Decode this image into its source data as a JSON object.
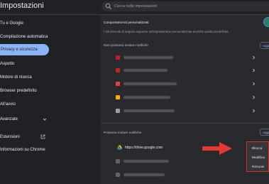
{
  "app": {
    "title": "Impostazioni"
  },
  "search": {
    "placeholder": "Cerca nelle impostazioni"
  },
  "sidebar": {
    "items": [
      {
        "label": "Tu e Google",
        "active": false
      },
      {
        "label": "Compilazione automatica",
        "active": false
      },
      {
        "label": "Privacy e sicurezza",
        "active": true
      },
      {
        "label": "Aspetto",
        "active": false
      },
      {
        "label": "Motore di ricerca",
        "active": false
      },
      {
        "label": "Browser predefinito",
        "active": false
      },
      {
        "label": "All'avvio",
        "active": false
      },
      {
        "label": "Avanzate",
        "active": false
      },
      {
        "label": "Estensioni",
        "active": false
      },
      {
        "label": "Informazioni su Chrome",
        "active": false
      }
    ]
  },
  "main": {
    "custom_behaviors": {
      "title": "Comportamenti personalizzati",
      "description": "I siti elencati di seguito seguono un'impostazione personalizzata anziché quella predefinita"
    },
    "blocked": {
      "heading": "Non possono inviare notifiche",
      "add_label": "Aggiungi",
      "favicon_colors": [
        "#c5221f",
        "#c5221f",
        "#ea4335",
        "#f9ab00",
        "#9aa0a6"
      ]
    },
    "allowed": {
      "heading": "Possono inviare notifiche",
      "add_label": "Aggiungi",
      "site_url": "https://drive.google.com"
    }
  },
  "context_menu": {
    "items": [
      "Blocca",
      "Modifica",
      "Rimuovi"
    ],
    "highlight_color": "#d93025"
  },
  "colors": {
    "background": "#202124",
    "card": "#292a2d",
    "accent": "#8ab4f8",
    "annotation_red": "#e53935"
  }
}
